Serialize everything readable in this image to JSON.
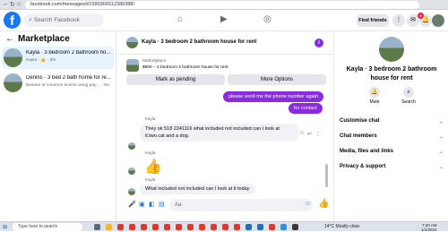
{
  "browser": {
    "url": "facebook.com/messages/t/1590366512380388/"
  },
  "fb_bar": {
    "search_placeholder": "Search Facebook",
    "find_friends_label": "Find friends",
    "notification_count": "6"
  },
  "left_panel": {
    "title": "Marketplace",
    "chats": [
      {
        "title": "Kayla · 3 bedroom 2 bathroom ho...",
        "subtitle": "Kayla · 👍 · 3m"
      },
      {
        "title": "Dennis · 3 bed 2 bath home for re...",
        "subtitle": "Beware of common scams using pay... · 3m"
      }
    ]
  },
  "chat": {
    "header_title": "Kayla · 3 bedroom 2 bathroom house for rent",
    "listing": {
      "kind": "Marketplace",
      "description": "$900 – 3 bedroom 2 bathroom house for rent"
    },
    "mark_pending_label": "Mark as pending",
    "more_options_label": "More Options",
    "messages": [
      {
        "direction": "out",
        "text": "please send me the phone number again"
      },
      {
        "direction": "out",
        "text": "for contact"
      },
      {
        "direction": "in",
        "sender": "Kayla",
        "text": "They ok  518 2241116 what included not included can I look at it.two.cat and a dog."
      },
      {
        "direction": "in",
        "sender": "Kayla",
        "text": "👍"
      },
      {
        "direction": "in",
        "sender": "Kayla",
        "text": "What included not included can I look at it today"
      }
    ],
    "composer_placeholder": "Aa"
  },
  "right_panel": {
    "title": "Kayla · 3 bedroom 2 bathroom house for rent",
    "mute_label": "Mute",
    "search_label": "Search",
    "sections": [
      "Customise chat",
      "Chat members",
      "Media, files and links",
      "Privacy & support"
    ]
  },
  "taskbar": {
    "search_placeholder": "Type here to search",
    "weather": "14°C  Mostly clear",
    "time": "7:20 AM",
    "date": "1/1/2024"
  }
}
